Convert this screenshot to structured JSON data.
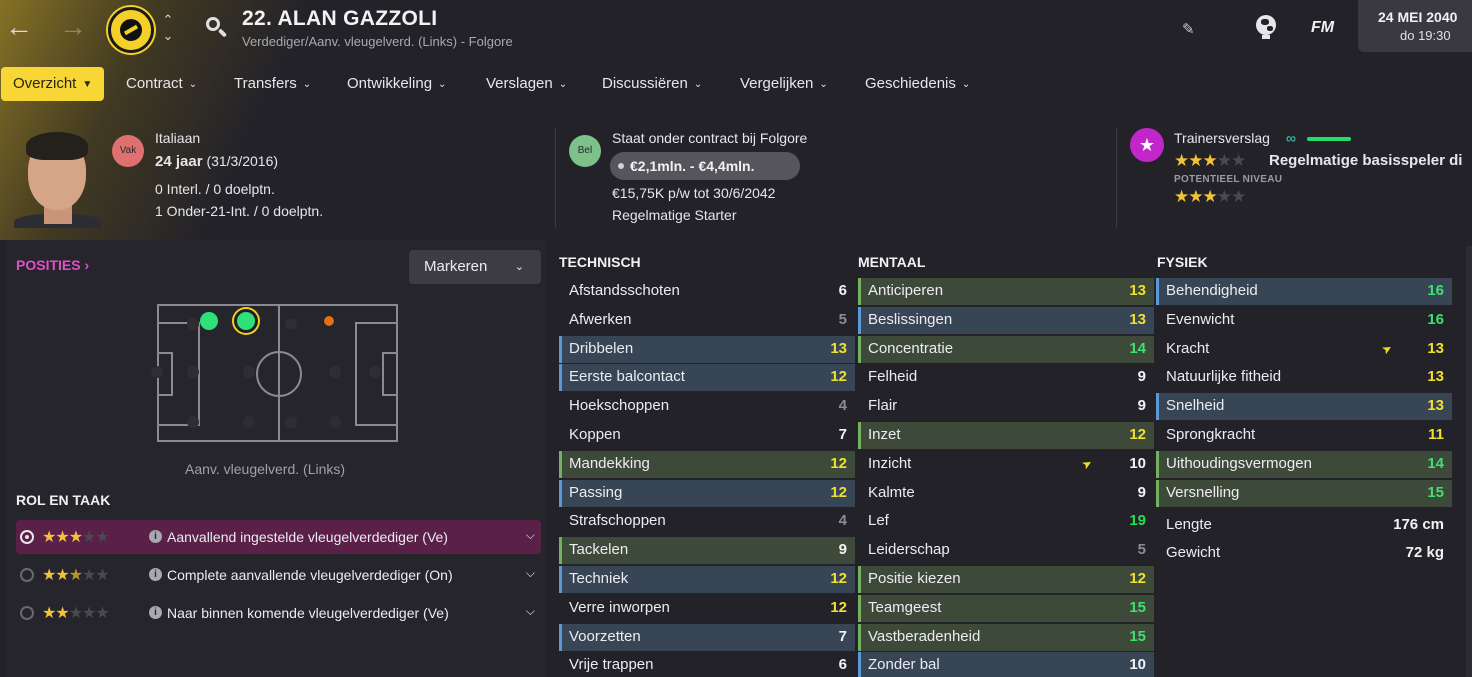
{
  "header": {
    "title": "22. ALAN GAZZOLI",
    "subtitle": "Verdediger/Aanv. vleugelverd. (Links) - Folgore",
    "fm_logo": "FM",
    "date": "24 MEI 2040",
    "time": "do 19:30",
    "icons": {
      "back": "arrow-left-icon",
      "forward": "arrow-right-icon",
      "updown": "chevron-up-down-icon",
      "search": "search-icon",
      "edit": "pencil-icon",
      "world": "globe-icon"
    }
  },
  "tabs": [
    {
      "label": "Overzicht",
      "active": true
    },
    {
      "label": "Contract"
    },
    {
      "label": "Transfers"
    },
    {
      "label": "Ontwikkeling"
    },
    {
      "label": "Verslagen"
    },
    {
      "label": "Discussiëren"
    },
    {
      "label": "Vergelijken"
    },
    {
      "label": "Geschiedenis"
    }
  ],
  "profile": {
    "badge": "Vak",
    "nationality": "Italiaan",
    "age": "24 jaar",
    "dob": "(31/3/2016)",
    "caps": "0 Interl. / 0 doelptn.",
    "u21_caps": "1 Onder-21-Int. / 0 doelptn."
  },
  "contract": {
    "badge": "Bel",
    "status": "Staat onder contract bij Folgore",
    "value": "€2,1mln. - €4,4mln.",
    "wage": "€15,75K p/w tot 30/6/2042",
    "role": "Regelmatige Starter"
  },
  "scout": {
    "label": "Trainersverslag",
    "current_stars": 3,
    "verdict": "Regelmatige basisspeler di",
    "potential_label": "POTENTIEEL NIVEAU",
    "potential_stars": 3
  },
  "positions": {
    "title": "POSITIES",
    "mark_button": "Markeren",
    "pitch_label": "Aanv. vleugelverd. (Links)"
  },
  "roles": {
    "title": "ROL EN TAAK",
    "items": [
      {
        "label": "Aanvallend ingestelde vleugelverdediger (Ve)",
        "stars": "3",
        "selected": true
      },
      {
        "label": "Complete aanvallende vleugelverdediger (On)",
        "stars": "2.5"
      },
      {
        "label": "Naar binnen komende vleugelverdediger (Ve)",
        "stars": "2"
      }
    ]
  },
  "attributes": {
    "technical": {
      "title": "TECHNISCH",
      "rows": [
        {
          "name": "Afstandsschoten",
          "value": "6"
        },
        {
          "name": "Afwerken",
          "value": "5"
        },
        {
          "name": "Dribbelen",
          "value": "13"
        },
        {
          "name": "Eerste balcontact",
          "value": "12"
        },
        {
          "name": "Hoekschoppen",
          "value": "4"
        },
        {
          "name": "Koppen",
          "value": "7"
        },
        {
          "name": "Mandekking",
          "value": "12"
        },
        {
          "name": "Passing",
          "value": "12"
        },
        {
          "name": "Strafschoppen",
          "value": "4"
        },
        {
          "name": "Tackelen",
          "value": "9"
        },
        {
          "name": "Techniek",
          "value": "12"
        },
        {
          "name": "Verre inworpen",
          "value": "12"
        },
        {
          "name": "Voorzetten",
          "value": "7"
        },
        {
          "name": "Vrije trappen",
          "value": "6"
        }
      ]
    },
    "mental": {
      "title": "MENTAAL",
      "rows": [
        {
          "name": "Anticiperen",
          "value": "13"
        },
        {
          "name": "Beslissingen",
          "value": "13"
        },
        {
          "name": "Concentratie",
          "value": "14"
        },
        {
          "name": "Felheid",
          "value": "9"
        },
        {
          "name": "Flair",
          "value": "9"
        },
        {
          "name": "Inzet",
          "value": "12"
        },
        {
          "name": "Inzicht",
          "value": "10"
        },
        {
          "name": "Kalmte",
          "value": "9"
        },
        {
          "name": "Lef",
          "value": "19"
        },
        {
          "name": "Leiderschap",
          "value": "5"
        },
        {
          "name": "Positie kiezen",
          "value": "12"
        },
        {
          "name": "Teamgeest",
          "value": "15"
        },
        {
          "name": "Vastberadenheid",
          "value": "15"
        },
        {
          "name": "Zonder bal",
          "value": "10"
        }
      ]
    },
    "physical": {
      "title": "FYSIEK",
      "rows": [
        {
          "name": "Behendigheid",
          "value": "16"
        },
        {
          "name": "Evenwicht",
          "value": "16"
        },
        {
          "name": "Kracht",
          "value": "13"
        },
        {
          "name": "Natuurlijke fitheid",
          "value": "13"
        },
        {
          "name": "Snelheid",
          "value": "13"
        },
        {
          "name": "Sprongkracht",
          "value": "11"
        },
        {
          "name": "Uithoudingsvermogen",
          "value": "14"
        },
        {
          "name": "Versnelling",
          "value": "15"
        }
      ],
      "height_label": "Lengte",
      "height": "176 cm",
      "weight_label": "Gewicht",
      "weight": "72 kg"
    }
  }
}
